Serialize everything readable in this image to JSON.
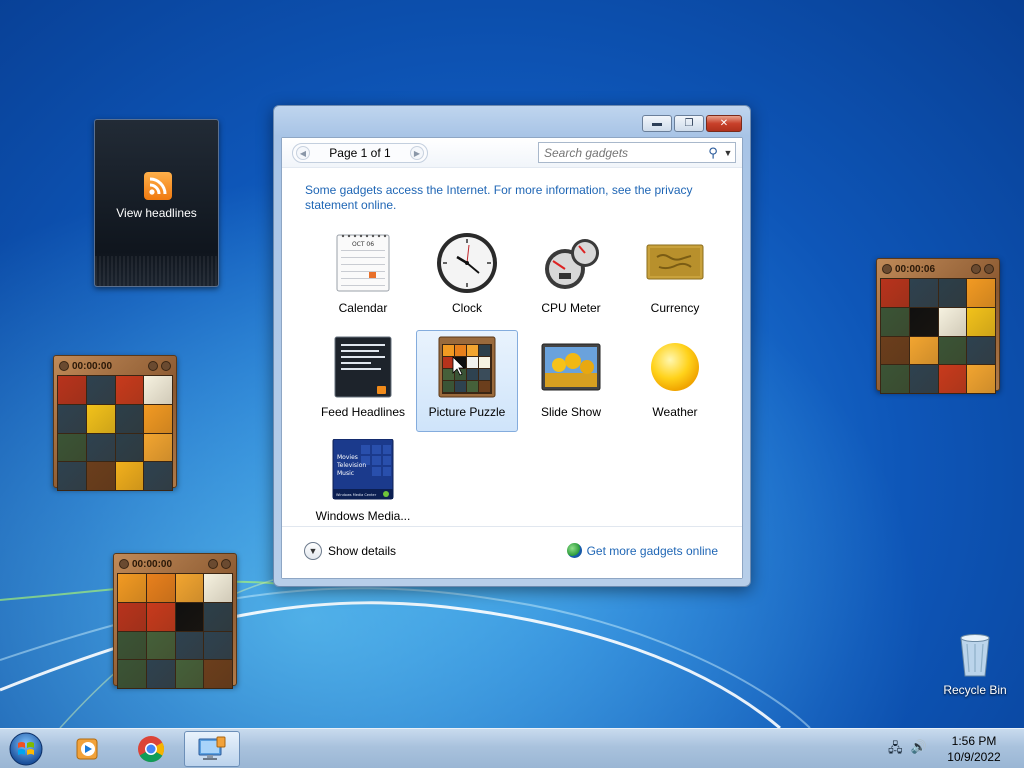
{
  "feed_gadget": {
    "label": "View headlines"
  },
  "puzzles": [
    {
      "id": "left",
      "time": "00:00:00"
    },
    {
      "id": "bottom",
      "time": "00:00:00"
    },
    {
      "id": "right",
      "time": "00:00:06"
    }
  ],
  "gallery": {
    "page_label": "Page 1 of 1",
    "search_placeholder": "Search gadgets",
    "notice": "Some gadgets access the Internet.  For more information, see the privacy statement online.",
    "items": [
      {
        "label": "Calendar",
        "icon": "calendar-icon",
        "selected": false
      },
      {
        "label": "Clock",
        "icon": "clock-icon",
        "selected": false
      },
      {
        "label": "CPU Meter",
        "icon": "cpu-meter-icon",
        "selected": false
      },
      {
        "label": "Currency",
        "icon": "currency-icon",
        "selected": false
      },
      {
        "label": "Feed Headlines",
        "icon": "feed-headlines-icon",
        "selected": false
      },
      {
        "label": "Picture Puzzle",
        "icon": "picture-puzzle-icon",
        "selected": true
      },
      {
        "label": "Slide Show",
        "icon": "slide-show-icon",
        "selected": false
      },
      {
        "label": "Weather",
        "icon": "weather-icon",
        "selected": false
      },
      {
        "label": "Windows Media...",
        "icon": "windows-media-center-icon",
        "selected": false
      }
    ],
    "show_details": "Show details",
    "get_more": "Get more gadgets online",
    "calendar_month": "OCT 06",
    "media_menu": [
      "Movies",
      "Television",
      "Music"
    ],
    "media_footer": "Windows Media Center"
  },
  "desktop": {
    "recycle_bin": "Recycle Bin"
  },
  "taskbar": {
    "apps": [
      "start-orb",
      "media-player",
      "chrome",
      "remote-desktop"
    ],
    "time": "1:56 PM",
    "date": "10/9/2022"
  },
  "colors": {
    "link": "#1f66b5",
    "selection": "#cfe4fa",
    "desktop": "#1a6fcf"
  }
}
